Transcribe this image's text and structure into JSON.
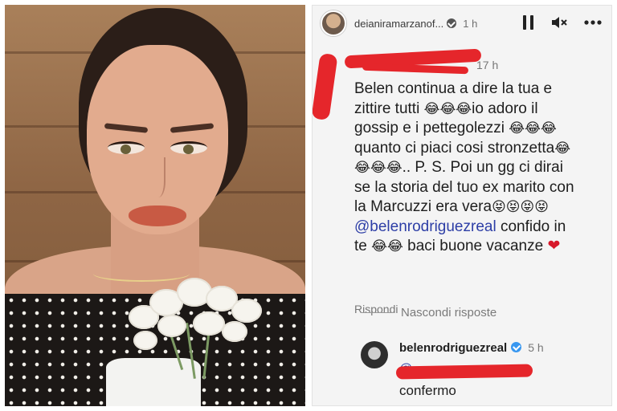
{
  "story": {
    "username": "deianiramarzanof...",
    "time": "1 h",
    "icons": [
      "pause-icon",
      "mute-icon",
      "more-icon"
    ]
  },
  "comment": {
    "username": "",
    "time": "17 h",
    "line1": "Belen continua a dire la tua e",
    "line2a": "zittire tutti ",
    "line2_emoji": "😂😂😂",
    "line2b": "io adoro il",
    "line3a": "gossip e i pettegolezzi ",
    "line3_emoji": "😂😂😂",
    "line4a": "quanto ci piaci cosi stronzetta",
    "line4_emoji": "😂",
    "line5_emoji": "😂😂😂",
    "line5b": ".. P. S. Poi un gg ci dirai",
    "line6": "se la storia del tuo ex marito con",
    "line7a": "la Marcuzzi era vera",
    "line7_emoji": "😝😝😝😝",
    "mention": "@belenrodriguezreal",
    "line8b": " confido in",
    "line9a": "te ",
    "line9_emoji": "😂😂",
    "line9b": " baci buone vacanze ",
    "heart": "❤",
    "reply_label": "Rispondi"
  },
  "hide_replies_label": "Nascondi risposte",
  "reply": {
    "username": "belenrodriguezreal",
    "time": "5 h",
    "mention": "@",
    "text": "confermo"
  },
  "colors": {
    "scribble": "#e5262b",
    "mention": "#2d3ea6",
    "verified": "#3897f0"
  }
}
